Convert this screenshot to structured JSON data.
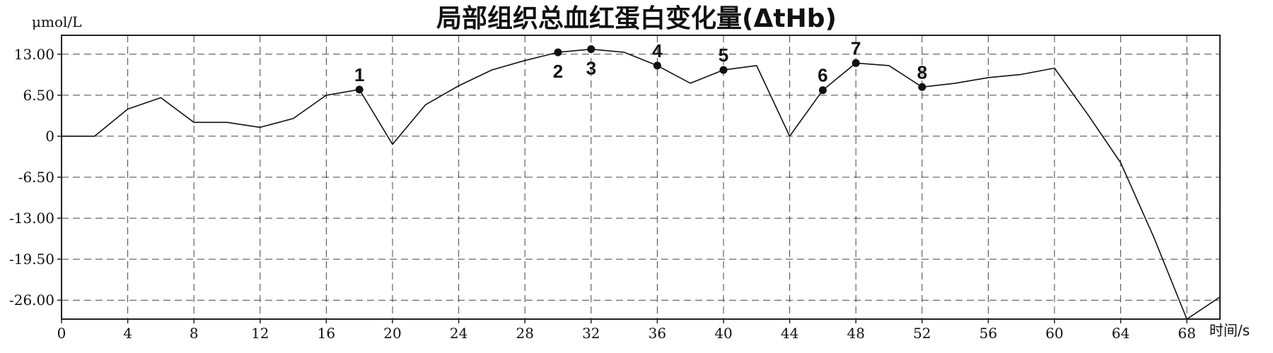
{
  "chart_data": {
    "type": "line",
    "title": "局部组织总血红蛋白变化量(ΔtHb)",
    "ylabel": "μmol/L",
    "xlabel": "时间/s",
    "xlim": [
      0,
      70
    ],
    "ylim": [
      -29,
      16
    ],
    "x_ticks": [
      0,
      4,
      8,
      12,
      16,
      20,
      24,
      28,
      32,
      36,
      40,
      44,
      48,
      52,
      56,
      60,
      64,
      68
    ],
    "x_tick_labels": [
      "0",
      "4",
      "8",
      "12",
      "16",
      "20",
      "24",
      "28",
      "32",
      "36",
      "40",
      "44",
      "48",
      "52",
      "56",
      "60",
      "64",
      "68"
    ],
    "y_ticks": [
      13,
      6.5,
      0,
      -6.5,
      -13,
      -19.5,
      -26
    ],
    "y_tick_labels": [
      "13.00",
      "6.50",
      "0",
      "-6.50",
      "-13.00",
      "-19.50",
      "-26.00"
    ],
    "grid": true,
    "series": [
      {
        "x": [
          0,
          2,
          4,
          6,
          8,
          10,
          12,
          14,
          16,
          18,
          20,
          22,
          24,
          26,
          28,
          30,
          32,
          34,
          36,
          38,
          40,
          42,
          44,
          46,
          48,
          50,
          52,
          54,
          56,
          58,
          60,
          62,
          64,
          66,
          68,
          70
        ],
        "y": [
          0,
          0,
          4.3,
          6.1,
          2.2,
          2.2,
          1.4,
          2.8,
          6.5,
          7.4,
          -1.3,
          5.0,
          8.0,
          10.5,
          12.0,
          13.3,
          13.8,
          13.3,
          11.2,
          8.4,
          10.5,
          11.2,
          0,
          7.3,
          11.6,
          11.2,
          7.8,
          8.4,
          9.3,
          9.8,
          10.8,
          3.5,
          -4.2,
          -16.0,
          -29.0,
          -25.5
        ]
      }
    ],
    "markers": [
      {
        "label": "1",
        "x": 18,
        "y": 7.4,
        "position": "above"
      },
      {
        "label": "2",
        "x": 30,
        "y": 13.3,
        "position": "below"
      },
      {
        "label": "3",
        "x": 32,
        "y": 13.8,
        "position": "below"
      },
      {
        "label": "4",
        "x": 36,
        "y": 11.2,
        "position": "above"
      },
      {
        "label": "5",
        "x": 40,
        "y": 10.5,
        "position": "above"
      },
      {
        "label": "6",
        "x": 46,
        "y": 7.3,
        "position": "above"
      },
      {
        "label": "7",
        "x": 48,
        "y": 11.6,
        "position": "above"
      },
      {
        "label": "8",
        "x": 52,
        "y": 7.8,
        "position": "above"
      }
    ]
  }
}
